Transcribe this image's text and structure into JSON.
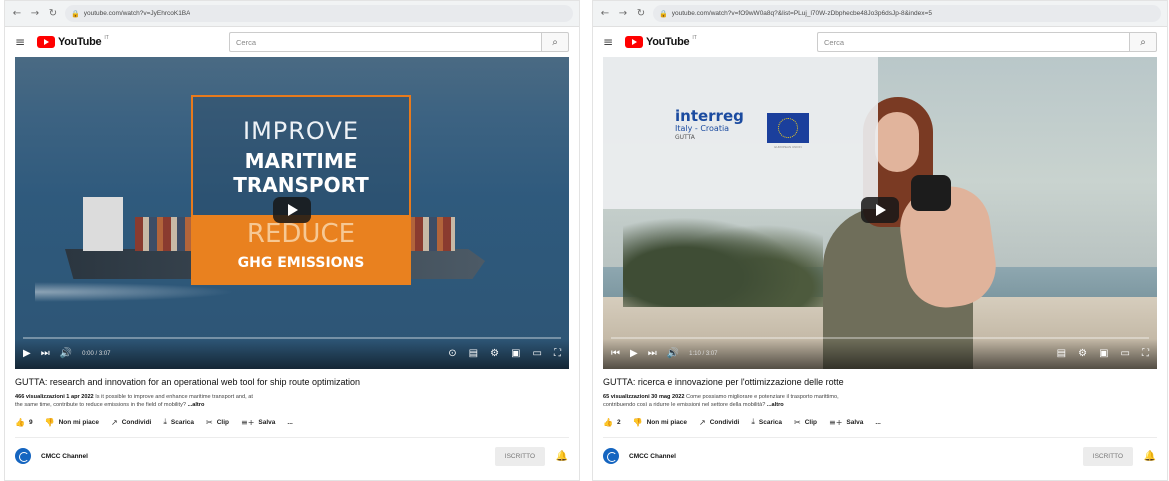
{
  "windows": [
    {
      "url": "youtube.com/watch?v=JyEhrcoK1BA",
      "logo_text": "YouTube",
      "logo_country": "IT",
      "search_placeholder": "Cerca",
      "time": "0:00 / 3:07",
      "title": "GUTTA: research and innovation for an operational web tool for ship route optimization",
      "views_date": "466 visualizzazioni  1 apr 2022",
      "desc_line1": "Is it possible to improve and enhance maritime transport and, at",
      "desc_line2": "the same time, contribute to reduce emissions in the field of mobility?",
      "more": "...altro",
      "likes": "9",
      "dislike": "Non mi piace",
      "share": "Condividi",
      "download": "Scarica",
      "clip": "Clip",
      "save": "Salva",
      "overflow": "...",
      "channel": "CMCC Channel",
      "subscribed": "ISCRITTO",
      "video_text": {
        "improve": "IMPROVE",
        "maritime": "MARITIME",
        "transport": "TRANSPORT",
        "reduce": "REDUCE",
        "ghg": "GHG EMISSIONS"
      }
    },
    {
      "url": "youtube.com/watch?v=fO9wW0a8q?&list=PLuj_l70W-zDbphecbe48Jo3p6dsJp-8&index=5",
      "logo_text": "YouTube",
      "logo_country": "IT",
      "search_placeholder": "Cerca",
      "time": "1:10 / 3:07",
      "title": "GUTTA: ricerca e innovazione per l'ottimizzazione delle rotte",
      "views_date": "65 visualizzazioni  30 mag 2022",
      "desc_line1": "Come possiamo migliorare e potenziare il trasporto marittimo,",
      "desc_line2": "contribuendo così a ridurre le emissioni nel settore della mobilità?",
      "more": "...altro",
      "likes": "2",
      "dislike": "Non mi piace",
      "share": "Condividi",
      "download": "Scarica",
      "clip": "Clip",
      "save": "Salva",
      "overflow": "...",
      "channel": "CMCC Channel",
      "subscribed": "ISCRITTO",
      "video_text": {
        "interreg": "interreg",
        "country": "Italy - Croatia",
        "project": "GUTTA",
        "eu_caption": "EUROPEAN UNION"
      }
    }
  ],
  "colors": {
    "youtube_red": "#ff0000",
    "orange": "#e9811f",
    "interreg_blue": "#1b4ba0",
    "eu_blue": "#1b3f9c"
  }
}
